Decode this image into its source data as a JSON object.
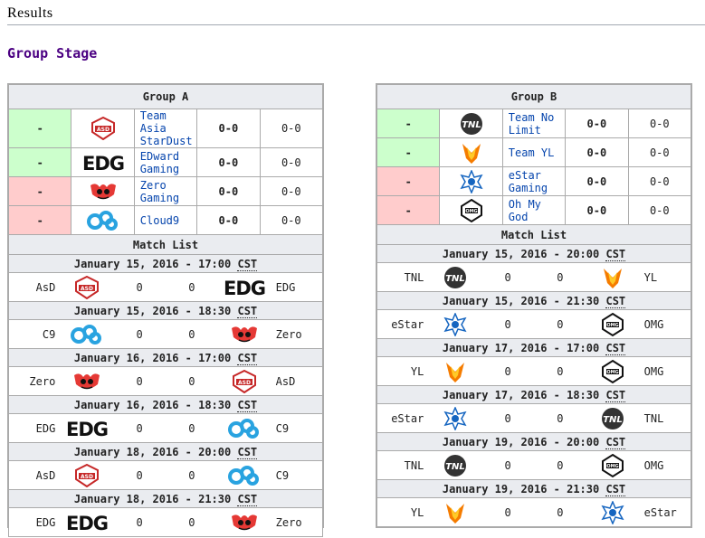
{
  "header": {
    "title": "Results"
  },
  "group_stage": {
    "title": "Group Stage"
  },
  "groups": [
    {
      "title": "Group A",
      "teams": [
        {
          "status": "-",
          "state": "adv",
          "logo": "asd",
          "name": "Team Asia StarDust",
          "score": "0-0",
          "games": "0-0"
        },
        {
          "status": "-",
          "state": "adv",
          "logo": "edg",
          "name": "EDward Gaming",
          "score": "0-0",
          "games": "0-0"
        },
        {
          "status": "-",
          "state": "elim",
          "logo": "zero",
          "name": "Zero Gaming",
          "score": "0-0",
          "games": "0-0"
        },
        {
          "status": "-",
          "state": "elim",
          "logo": "c9",
          "name": "Cloud9",
          "score": "0-0",
          "games": "0-0"
        }
      ],
      "match_list_label": "Match List",
      "matches": [
        {
          "date": "January 15, 2016 - 17:00",
          "tz": "CST",
          "t1": "AsD",
          "t1logo": "asd",
          "s1": "0",
          "s2": "0",
          "t2logo": "edg",
          "t2": "EDG"
        },
        {
          "date": "January 15, 2016 - 18:30",
          "tz": "CST",
          "t1": "C9",
          "t1logo": "c9",
          "s1": "0",
          "s2": "0",
          "t2logo": "zero",
          "t2": "Zero"
        },
        {
          "date": "January 16, 2016 - 17:00",
          "tz": "CST",
          "t1": "Zero",
          "t1logo": "zero",
          "s1": "0",
          "s2": "0",
          "t2logo": "asd",
          "t2": "AsD"
        },
        {
          "date": "January 16, 2016 - 18:30",
          "tz": "CST",
          "t1": "EDG",
          "t1logo": "edg",
          "s1": "0",
          "s2": "0",
          "t2logo": "c9",
          "t2": "C9"
        },
        {
          "date": "January 18, 2016 - 20:00",
          "tz": "CST",
          "t1": "AsD",
          "t1logo": "asd",
          "s1": "0",
          "s2": "0",
          "t2logo": "c9",
          "t2": "C9"
        },
        {
          "date": "January 18, 2016 - 21:30",
          "tz": "CST",
          "t1": "EDG",
          "t1logo": "edg",
          "s1": "0",
          "s2": "0",
          "t2logo": "zero",
          "t2": "Zero"
        }
      ]
    },
    {
      "title": "Group B",
      "teams": [
        {
          "status": "-",
          "state": "adv",
          "logo": "tnl",
          "name": "Team No Limit",
          "score": "0-0",
          "games": "0-0"
        },
        {
          "status": "-",
          "state": "adv",
          "logo": "yl",
          "name": "Team YL",
          "score": "0-0",
          "games": "0-0"
        },
        {
          "status": "-",
          "state": "elim",
          "logo": "estar",
          "name": "eStar Gaming",
          "score": "0-0",
          "games": "0-0"
        },
        {
          "status": "-",
          "state": "elim",
          "logo": "omg",
          "name": "Oh My God",
          "score": "0-0",
          "games": "0-0"
        }
      ],
      "match_list_label": "Match List",
      "matches": [
        {
          "date": "January 15, 2016 - 20:00",
          "tz": "CST",
          "t1": "TNL",
          "t1logo": "tnl",
          "s1": "0",
          "s2": "0",
          "t2logo": "yl",
          "t2": "YL"
        },
        {
          "date": "January 15, 2016 - 21:30",
          "tz": "CST",
          "t1": "eStar",
          "t1logo": "estar",
          "s1": "0",
          "s2": "0",
          "t2logo": "omg",
          "t2": "OMG"
        },
        {
          "date": "January 17, 2016 - 17:00",
          "tz": "CST",
          "t1": "YL",
          "t1logo": "yl",
          "s1": "0",
          "s2": "0",
          "t2logo": "omg",
          "t2": "OMG"
        },
        {
          "date": "January 17, 2016 - 18:30",
          "tz": "CST",
          "t1": "eStar",
          "t1logo": "estar",
          "s1": "0",
          "s2": "0",
          "t2logo": "tnl",
          "t2": "TNL"
        },
        {
          "date": "January 19, 2016 - 20:00",
          "tz": "CST",
          "t1": "TNL",
          "t1logo": "tnl",
          "s1": "0",
          "s2": "0",
          "t2logo": "omg",
          "t2": "OMG"
        },
        {
          "date": "January 19, 2016 - 21:30",
          "tz": "CST",
          "t1": "YL",
          "t1logo": "yl",
          "s1": "0",
          "s2": "0",
          "t2logo": "estar",
          "t2": "eStar"
        }
      ]
    }
  ],
  "colors": {
    "advance": "#ccffcc",
    "eliminated": "#ffcccc",
    "header_bg": "#eaecf0",
    "link": "#0645ad",
    "section_title": "#4b0082"
  }
}
